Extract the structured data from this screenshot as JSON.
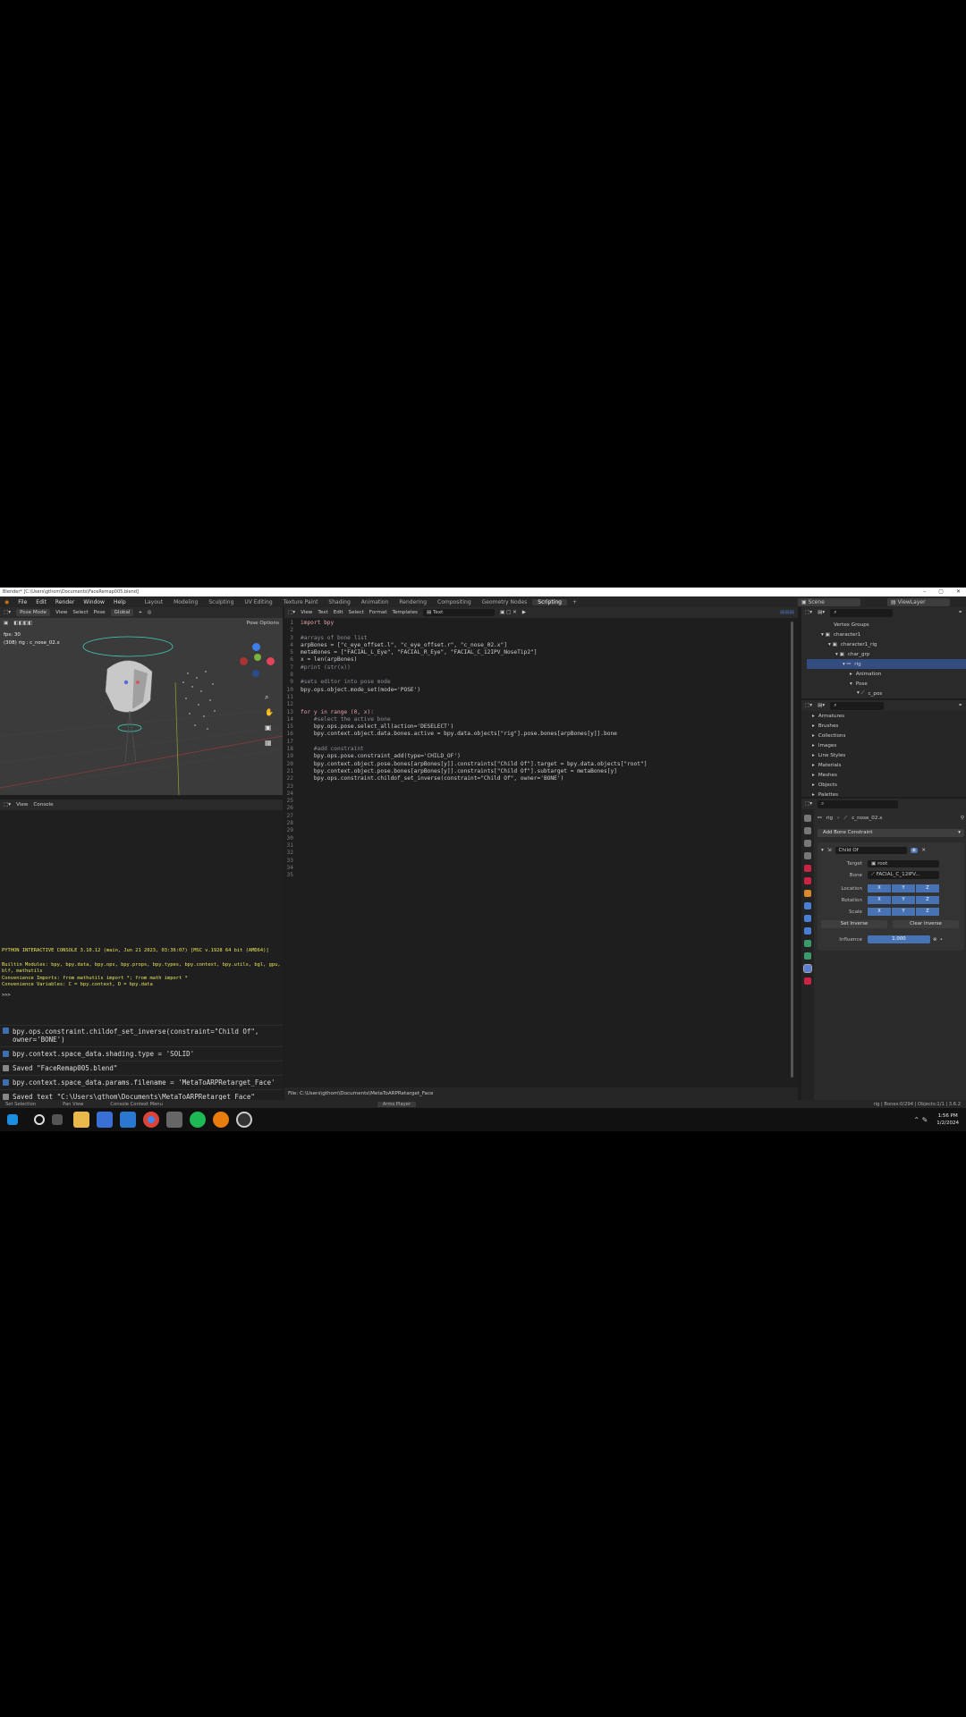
{
  "window": {
    "title": "Blender* [C:\\Users\\gthom\\Documents\\FaceRemap005.blend]"
  },
  "menu": [
    "File",
    "Edit",
    "Render",
    "Window",
    "Help"
  ],
  "workspaces": [
    "Layout",
    "Modeling",
    "Sculpting",
    "UV Editing",
    "Texture Paint",
    "Shading",
    "Animation",
    "Rendering",
    "Compositing",
    "Geometry Nodes",
    "Scripting"
  ],
  "active_workspace": "Scripting",
  "scene": {
    "scene_name": "Scene",
    "view_layer": "ViewLayer"
  },
  "viewport": {
    "mode": "Pose Mode",
    "menus": [
      "View",
      "Select",
      "Pose"
    ],
    "orientation": "Global",
    "options_label": "Pose Options",
    "info_line1": "fps: 30",
    "info_line2": "(308) rig : c_nose_02.x"
  },
  "text_editor": {
    "menus": [
      "View",
      "Text",
      "Edit",
      "Select",
      "Format",
      "Templates"
    ],
    "filename": "Text",
    "status": "File: C:\\Users\\gthom\\Documents\\MetaToARPRetarget_Face",
    "lines": [
      "import bpy",
      "",
      "#arrays of bone list",
      "arpBones = [\"c_eye_offset.l\", \"c_eye_offset.r\", \"c_nose_02.x\"]",
      "metaBones = [\"FACIAL_L_Eye\", \"FACIAL_R_Eye\", \"FACIAL_C_12IPV_NoseTip2\"]",
      "x = len(arpBones)",
      "#print (str(x))",
      "",
      "#sets editor into pose mode",
      "bpy.ops.object.mode_set(mode='POSE')",
      "",
      "",
      "for y in range (0, x):",
      "    #select the active bone",
      "    bpy.ops.pose.select_all(action='DESELECT')",
      "    bpy.context.object.data.bones.active = bpy.data.objects[\"rig\"].pose.bones[arpBones[y]].bone",
      "",
      "    #add constraint",
      "    bpy.ops.pose.constraint_add(type='CHILD_OF')",
      "    bpy.context.object.pose.bones[arpBones[y]].constraints[\"Child Of\"].target = bpy.data.objects[\"root\"]",
      "    bpy.context.object.pose.bones[arpBones[y]].constraints[\"Child Of\"].subtarget = metaBones[y]",
      "    bpy.ops.constraint.childof_set_inverse(constraint=\"Child Of\", owner='BONE')",
      "",
      "",
      "",
      "",
      "",
      "",
      "",
      "",
      "",
      "",
      "",
      "",
      ""
    ]
  },
  "console": {
    "menus": [
      "View",
      "Console"
    ],
    "banner": "PYTHON INTERACTIVE CONSOLE 3.10.12 (main, Jun 21 2023, 03:36:07) [MSC v.1928 64 bit (AMD64)]",
    "builtin": "Builtin Modules:       bpy, bpy.data, bpy.ops, bpy.props, bpy.types, bpy.context, bpy.utils, bgl, gpu, blf, mathutils",
    "imports": "Convenience Imports:   from mathutils import *; from math import *",
    "variables": "Convenience Variables: C = bpy.context, D = bpy.data",
    "prompt": ">>>",
    "history": [
      "bpy.ops.constraint.childof_set_inverse(constraint=\"Child Of\", owner='BONE')",
      "bpy.context.space_data.shading.type = 'SOLID'",
      "Saved \"FaceRemap005.blend\"",
      "bpy.context.space_data.params.filename = 'MetaToARPRetarget_Face'",
      "Saved text \"C:\\Users\\gthom\\Documents\\MetaToARPRetarget_Face\""
    ]
  },
  "outliner": {
    "items": [
      "Vertex Groups",
      "character1",
      "character1_rig",
      "char_grp",
      "rig",
      "Animation",
      "Pose",
      "c_pos"
    ]
  },
  "data_browser": {
    "items": [
      "Armatures",
      "Brushes",
      "Collections",
      "Images",
      "Line Styles",
      "Materials",
      "Meshes",
      "Objects",
      "Palettes"
    ]
  },
  "properties": {
    "breadcrumb_object": "rig",
    "breadcrumb_bone": "c_nose_02.x",
    "add_constraint": "Add Bone Constraint",
    "constraint_name": "Child Of",
    "target_label": "Target",
    "target_value": "root",
    "bone_label": "Bone",
    "bone_value": "FACIAL_C_12IPV...",
    "location_label": "Location",
    "rotation_label": "Rotation",
    "scale_label": "Scale",
    "axes": [
      "X",
      "Y",
      "Z"
    ],
    "set_inverse": "Set Inverse",
    "clear_inverse": "Clear Inverse",
    "influence_label": "Influence",
    "influence_value": "1.000"
  },
  "statusbar": {
    "left": [
      "Set Selection",
      "Pan View",
      "Console Context Menu"
    ],
    "center": "Arms Player",
    "right": "rig | Bones:0/294 | Objects:1/1 | 3.6.2"
  },
  "taskbar": {
    "time": "1:56 PM",
    "date": "1/2/2024"
  },
  "colors": {
    "accent": "#4772b3",
    "bg": "#1d1d1d",
    "panel": "#2a2a2a",
    "console_yellow": "#e8e35a"
  }
}
